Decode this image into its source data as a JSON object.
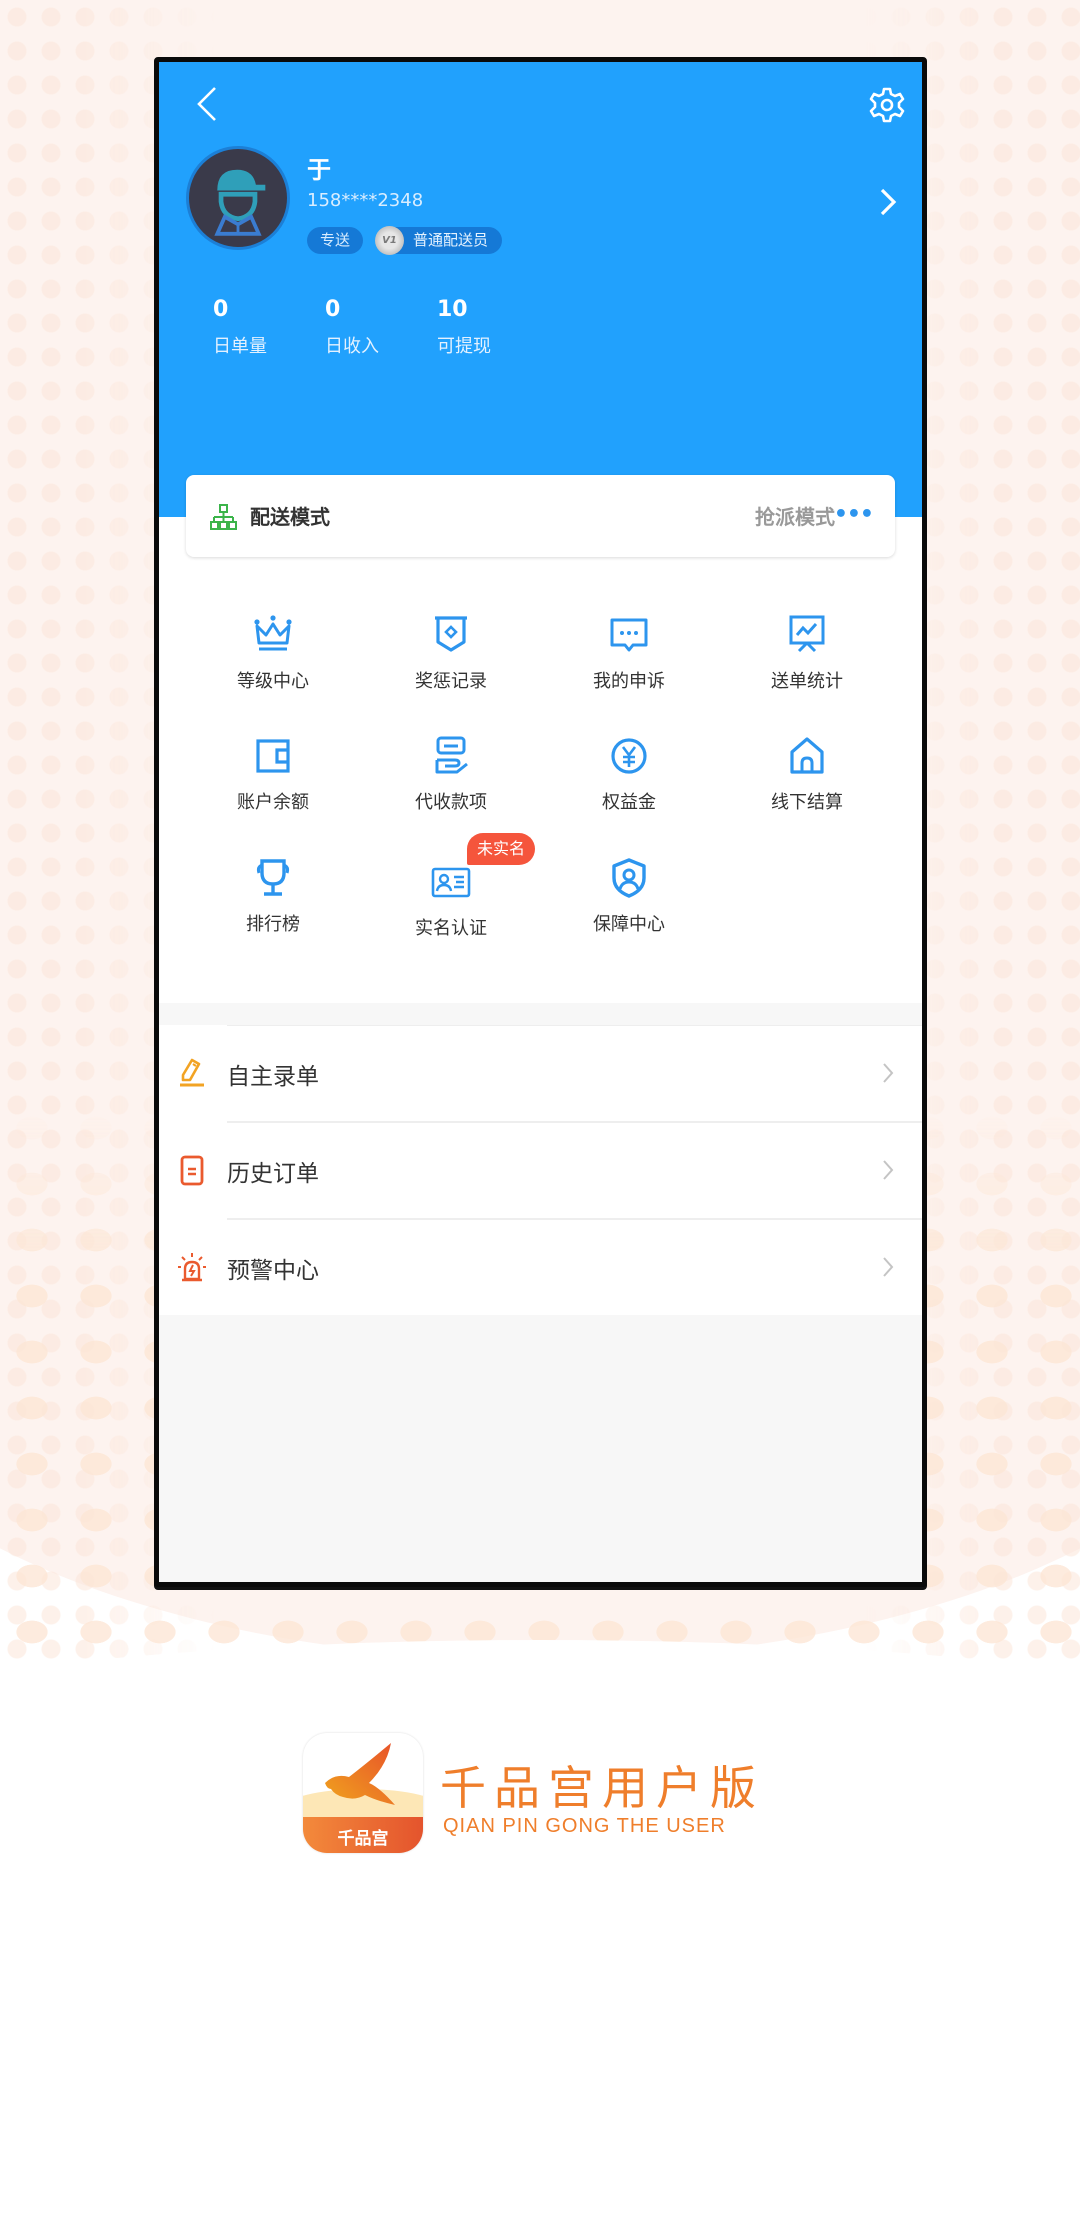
{
  "profile": {
    "name": "于",
    "phone": "158****2348",
    "tags": [
      "专送",
      "普通配送员"
    ],
    "level_badge": "V1"
  },
  "stats": [
    {
      "value": "0",
      "label": "日单量"
    },
    {
      "value": "0",
      "label": "日收入"
    },
    {
      "value": "10",
      "label": "可提现"
    }
  ],
  "delivery_mode": {
    "title": "配送模式",
    "current": "抢派模式",
    "more": "•••"
  },
  "grid": [
    {
      "label": "等级中心",
      "icon": "crown-icon"
    },
    {
      "label": "奖惩记录",
      "icon": "pennant-icon"
    },
    {
      "label": "我的申诉",
      "icon": "chat-bubble-icon"
    },
    {
      "label": "送单统计",
      "icon": "chart-board-icon"
    },
    {
      "label": "账户余额",
      "icon": "wallet-icon"
    },
    {
      "label": "代收款项",
      "icon": "hand-money-icon"
    },
    {
      "label": "权益金",
      "icon": "yuan-coin-icon"
    },
    {
      "label": "线下结算",
      "icon": "house-icon"
    },
    {
      "label": "排行榜",
      "icon": "trophy-icon"
    },
    {
      "label": "实名认证",
      "icon": "id-card-icon",
      "badge": "未实名"
    },
    {
      "label": "保障中心",
      "icon": "shield-user-icon"
    }
  ],
  "list": [
    {
      "label": "自主录单",
      "icon": "pencil-icon"
    },
    {
      "label": "历史订单",
      "icon": "document-icon"
    },
    {
      "label": "预警中心",
      "icon": "alarm-icon"
    }
  ],
  "branding": {
    "app_icon_text": "千品宫",
    "title": "千品宫用户版",
    "subtitle": "QIAN PIN GONG THE USER"
  },
  "colors": {
    "header_blue": "#21a1fd",
    "icon_blue": "#2d95ee",
    "badge_red": "#f5553c",
    "brand_orange": "#ef7e2b",
    "green": "#3bb44a"
  }
}
